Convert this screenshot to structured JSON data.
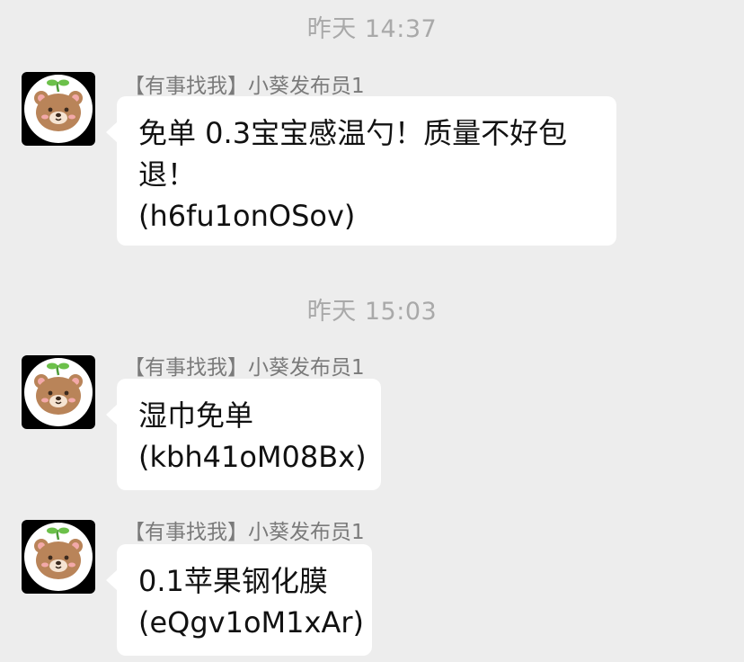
{
  "timestamps": [
    "昨天 14:37",
    "昨天 15:03"
  ],
  "messages": [
    {
      "sender": "【有事找我】小葵发布员1",
      "lines": [
        "免单 0.3宝宝感温勺！质量不好包",
        "退！",
        "(h6fu1onOSov)"
      ],
      "avatar_icon": "bear-avatar-icon"
    },
    {
      "sender": "【有事找我】小葵发布员1",
      "lines": [
        "湿巾免单",
        "(kbh41oM08Bx)"
      ],
      "avatar_icon": "bear-avatar-icon"
    },
    {
      "sender": "【有事找我】小葵发布员1",
      "lines": [
        "0.1苹果钢化膜",
        "(eQgv1oM1xAr)"
      ],
      "avatar_icon": "bear-avatar-icon"
    }
  ],
  "colors": {
    "background": "#ededed",
    "bubble": "#ffffff",
    "timestamp": "#a9a9a9",
    "sender": "#7a7a7a",
    "bear": "#b98459"
  }
}
